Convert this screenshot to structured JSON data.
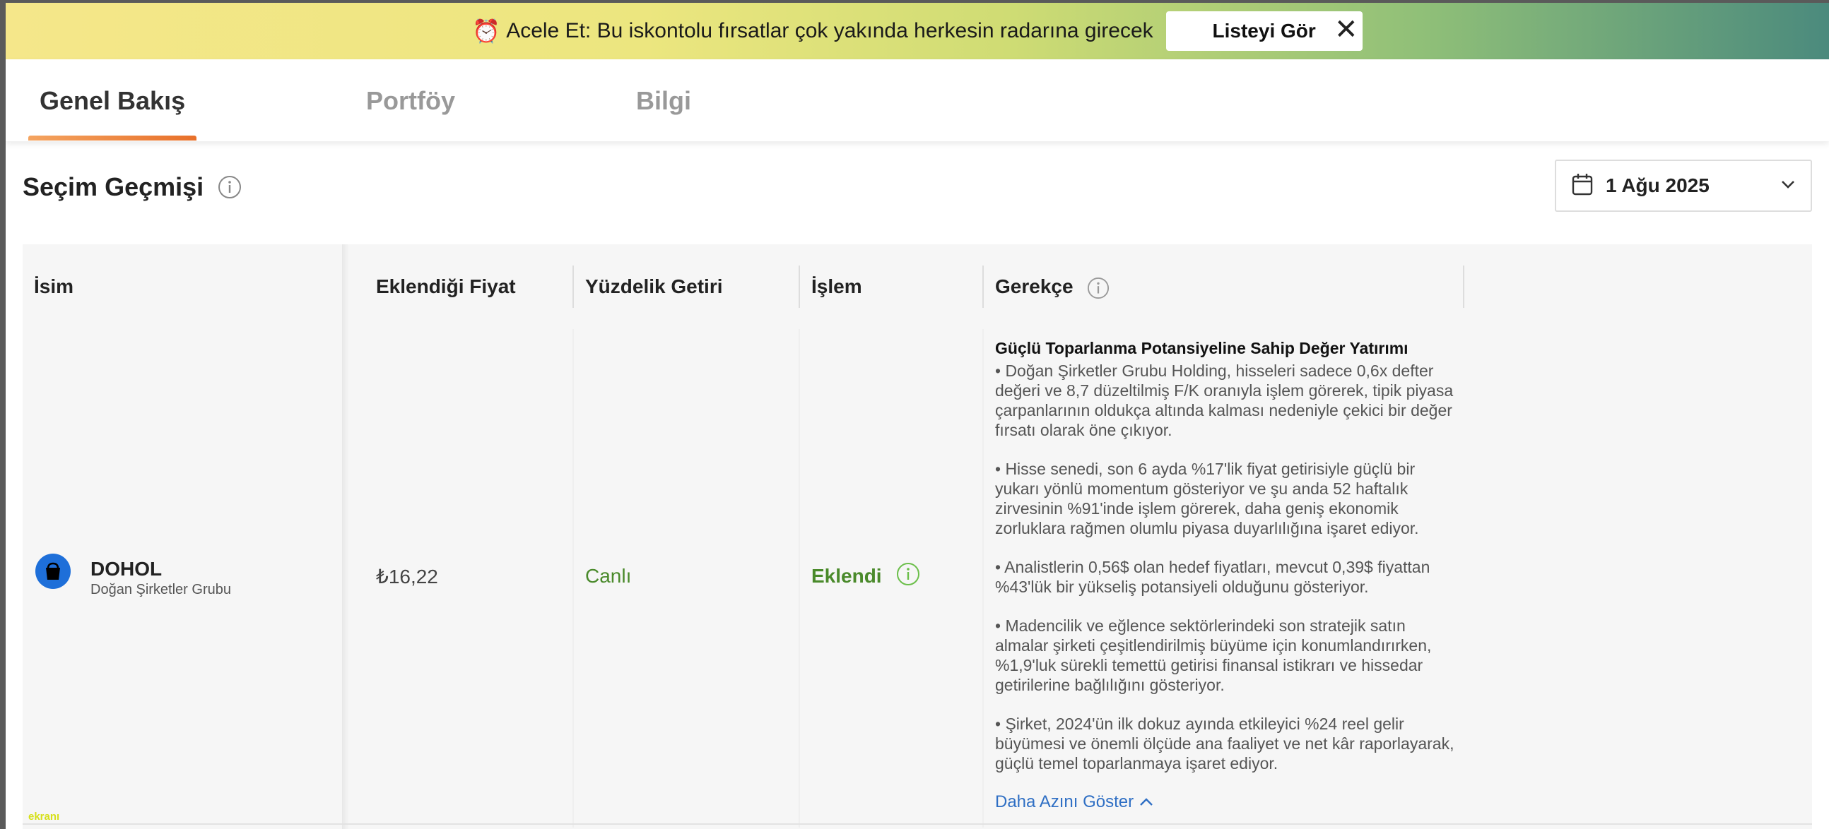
{
  "banner": {
    "clock_icon": "alarm-clock-icon",
    "text": "Acele Et: Bu iskontolu fırsatlar çok yakında herkesin radarına girecek",
    "button_label": "Listeyi Gör",
    "close_icon": "close-icon"
  },
  "tabs": [
    {
      "label": "Genel Bakış",
      "active": true
    },
    {
      "label": "Portföy",
      "active": false
    },
    {
      "label": "Bilgi",
      "active": false
    }
  ],
  "section": {
    "title": "Seçim Geçmişi",
    "date": "1 Ağu 2025"
  },
  "table": {
    "headers": [
      "İsim",
      "Eklendiği Fiyat",
      "Yüzdelik Getiri",
      "İşlem",
      "Gerekçe"
    ],
    "rows": [
      {
        "ticker": "DOHOL",
        "company": "Doğan Şirketler Grubu",
        "price": "₺16,22",
        "return": "Canlı",
        "action": "Eklendi",
        "rationale_title": "Güçlü Toparlanma Potansiyeline Sahip Değer Yatırımı",
        "bullets": [
          "• Doğan Şirketler Grubu Holding, hisseleri sadece 0,6x defter değeri ve 8,7 düzeltilmiş F/K oranıyla işlem görerek, tipik piyasa çarpanlarının oldukça altında kalması nedeniyle çekici bir değer fırsatı olarak öne çıkıyor.",
          "• Hisse senedi, son 6 ayda %17'lik fiyat getirisiyle güçlü bir yukarı yönlü momentum gösteriyor ve şu anda 52 haftalık zirvesinin %91'inde işlem görerek, daha geniş ekonomik zorluklara rağmen olumlu piyasa duyarlılığına işaret ediyor.",
          "• Analistlerin 0,56$ olan hedef fiyatları, mevcut 0,39$ fiyattan %43'lük bir yükseliş potansiyeli olduğunu gösteriyor.",
          "• Madencilik ve eğlence sektörlerindeki son stratejik satın almalar şirketi çeşitlendirilmiş büyüme için konumlandırırken, %1,9'luk sürekli temettü getirisi finansal istikrarı ve hissedar getirilerine bağlılığını gösteriyor.",
          "• Şirket, 2024'ün ilk dokuz ayında etkileyici %24 reel gelir büyümesi ve önemli ölçüde ana faaliyet ve net kâr raporlayarak, güçlü temel toparlanmaya işaret ediyor."
        ],
        "show_less": "Daha Azını Göster"
      }
    ]
  },
  "watermark": "ekranı",
  "colors": {
    "accent_green": "#4a8a2b",
    "link_blue": "#2f6fc4",
    "tab_underline": "#e8702a",
    "avatar_blue": "#1e6fd9"
  }
}
